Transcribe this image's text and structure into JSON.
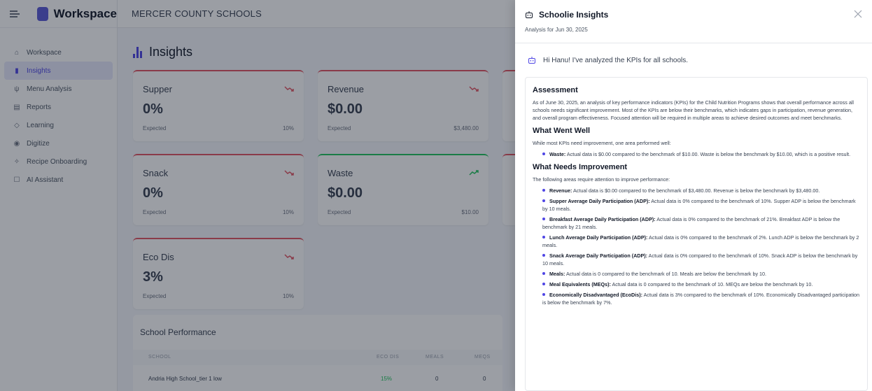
{
  "sidebar": {
    "brand": "Workspace",
    "items": [
      {
        "label": "Workspace",
        "icon": "home-icon"
      },
      {
        "label": "Insights",
        "icon": "bar-chart-icon",
        "active": true
      },
      {
        "label": "Menu Analysis",
        "icon": "utensils-icon"
      },
      {
        "label": "Reports",
        "icon": "document-icon"
      },
      {
        "label": "Learning",
        "icon": "graduation-cap-icon"
      },
      {
        "label": "Digitize",
        "icon": "camera-icon"
      },
      {
        "label": "Recipe Onboarding",
        "icon": "wand-icon"
      },
      {
        "label": "AI Assistant",
        "icon": "bot-icon"
      }
    ]
  },
  "topbar": {
    "district": "MERCER COUNTY SCHOOLS"
  },
  "page": {
    "title": "Insights"
  },
  "kpis": [
    {
      "label": "Supper",
      "value": "0%",
      "expected_label": "Expected",
      "expected": "10%",
      "trend": "down"
    },
    {
      "label": "Revenue",
      "value": "$0.00",
      "expected_label": "Expected",
      "expected": "$3,480.00",
      "trend": "down"
    },
    {
      "label": "Snack",
      "value": "0%",
      "expected_label": "Expected",
      "expected": "10%",
      "trend": "down"
    },
    {
      "label": "Waste",
      "value": "$0.00",
      "expected_label": "Expected",
      "expected": "$10.00",
      "trend": "up"
    },
    {
      "label": "Eco Dis",
      "value": "3%",
      "expected_label": "Expected",
      "expected": "10%",
      "trend": "down"
    }
  ],
  "performance": {
    "title": "School Performance",
    "columns": [
      "SCHOOL",
      "ECO DIS",
      "MEALS",
      "MEQS"
    ],
    "rows": [
      {
        "school": "Andria High School_tier 1 low",
        "eco_dis": "15%",
        "meals": "0",
        "meqs": "0"
      }
    ]
  },
  "drawer": {
    "title": "Schoolie Insights",
    "subtitle": "Analysis for Jun 30, 2025",
    "greeting": "Hi Hanu! I've analyzed the KPIs for all schools.",
    "assessment_title": "Assessment",
    "assessment_text": "As of June 30, 2025, an analysis of key performance indicators (KPIs) for the Child Nutrition Programs shows that overall performance across all schools needs significant improvement. Most of the KPIs are below their benchmarks, which indicates gaps in participation, revenue generation, and overall program effectiveness. Focused attention will be required in multiple areas to achieve desired outcomes and meet benchmarks.",
    "went_well_title": "What Went Well",
    "went_well_intro": "While most KPIs need improvement, one area performed well:",
    "went_well_items": [
      {
        "term": "Waste:",
        "text": " Actual data is $0.00 compared to the benchmark of $10.00. Waste is below the benchmark by $10.00, which is a positive result."
      }
    ],
    "improve_title": "What Needs Improvement",
    "improve_intro": "The following areas require attention to improve performance:",
    "improve_items": [
      {
        "term": "Revenue:",
        "text": " Actual data is $0.00 compared to the benchmark of $3,480.00. Revenue is below the benchmark by $3,480.00."
      },
      {
        "term": "Supper Average Daily Participation (ADP):",
        "text": " Actual data is 0% compared to the benchmark of 10%. Supper ADP is below the benchmark by 10 meals."
      },
      {
        "term": "Breakfast Average Daily Participation (ADP):",
        "text": " Actual data is 0% compared to the benchmark of 21%. Breakfast ADP is below the benchmark by 21 meals."
      },
      {
        "term": "Lunch Average Daily Participation (ADP):",
        "text": " Actual data is 0% compared to the benchmark of 2%. Lunch ADP is below the benchmark by 2 meals."
      },
      {
        "term": "Snack Average Daily Participation (ADP):",
        "text": " Actual data is 0% compared to the benchmark of 10%. Snack ADP is below the benchmark by 10 meals."
      },
      {
        "term": "Meals:",
        "text": " Actual data is 0 compared to the benchmark of 10. Meals are below the benchmark by 10."
      },
      {
        "term": "Meal Equivalents (MEQs):",
        "text": " Actual data is 0 compared to the benchmark of 10. MEQs are below the benchmark by 10."
      },
      {
        "term": "Economically Disadvantaged (EcoDis):",
        "text": " Actual data is 3% compared to the benchmark of 10%. Economically Disadvantaged participation is below the benchmark by 7%."
      }
    ]
  },
  "colors": {
    "accent": "#4f46e5",
    "bad": "#e25563",
    "good": "#22c55e",
    "eco_dis_value": "#22c55e"
  }
}
